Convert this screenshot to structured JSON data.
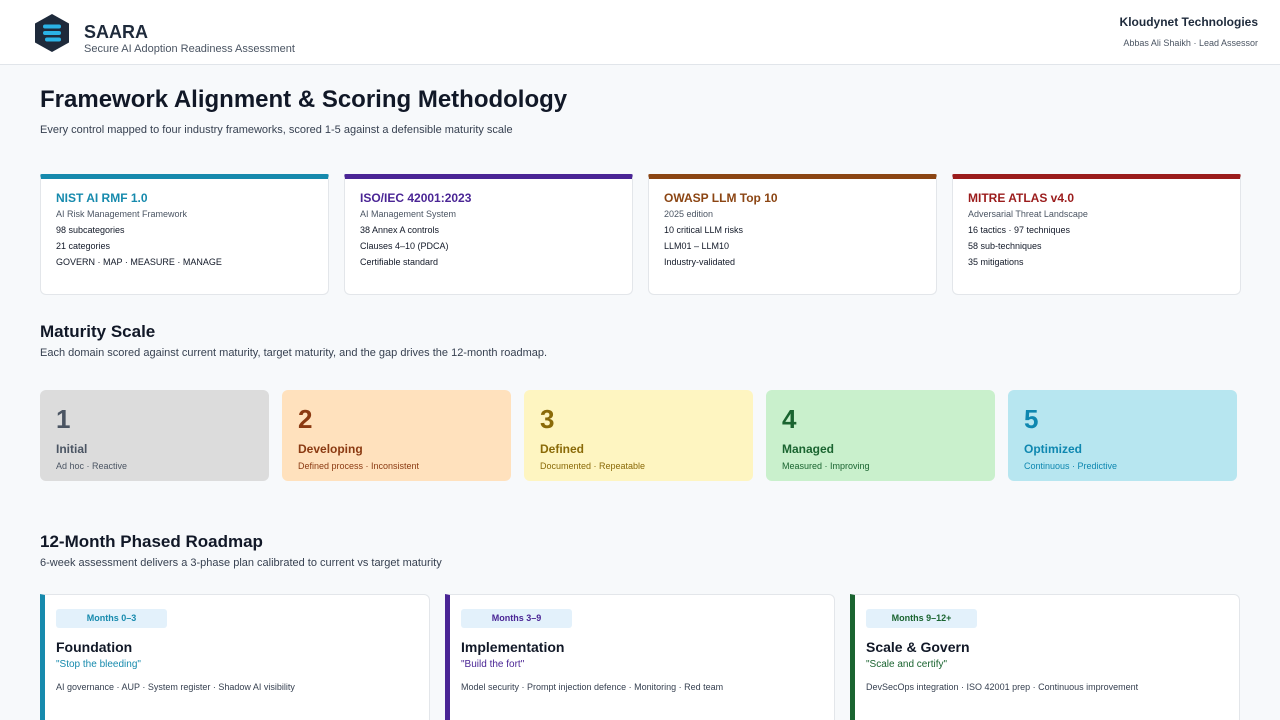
{
  "header": {
    "brand": "SAARA",
    "subtitle": "Secure AI Adoption Readiness Assessment",
    "company": "Kloudynet Technologies",
    "assessor_name": "Abbas Ali Shaikh",
    "assessor_sep": "·",
    "assessor_role": "Lead Assessor",
    "logo_icon": "stacked-layers-hexagon-icon"
  },
  "page": {
    "title": "Framework Alignment & Scoring Methodology",
    "subtitle": "Every control mapped to four industry frameworks, scored 1-5 against a defensible maturity scale"
  },
  "frameworks": [
    {
      "name": "NIST AI RMF 1.0",
      "desc": "AI Risk Management Framework",
      "lines": [
        "98 subcategories",
        "21 categories",
        "GOVERN · MAP · MEASURE · MANAGE"
      ],
      "color": "#168aad"
    },
    {
      "name": "ISO/IEC 42001:2023",
      "desc": "AI Management System",
      "lines": [
        "38 Annex A controls",
        "Clauses 4–10 (PDCA)",
        "Certifiable standard"
      ],
      "color": "#4a2595"
    },
    {
      "name": "OWASP LLM Top 10",
      "desc": "2025 edition",
      "lines": [
        "10 critical LLM risks",
        "LLM01 – LLM10",
        "Industry-validated"
      ],
      "color": "#8b4513"
    },
    {
      "name": "MITRE ATLAS v4.0",
      "desc": "Adversarial Threat Landscape",
      "lines": [
        "16 tactics · 97 techniques",
        "58 sub-techniques",
        "35 mitigations"
      ],
      "color": "#9b1c1c"
    }
  ],
  "maturity": {
    "title": "Maturity Scale",
    "subtitle": "Each domain scored against current maturity, target maturity, and the gap drives the 12-month roadmap.",
    "levels": [
      {
        "num": "1",
        "name": "Initial",
        "desc": "Ad hoc · Reactive",
        "bg": "#dcdcdc",
        "fg": "#4b5563"
      },
      {
        "num": "2",
        "name": "Developing",
        "desc": "Defined process · Inconsistent",
        "bg": "#ffe1bd",
        "fg": "#8b3a12"
      },
      {
        "num": "3",
        "name": "Defined",
        "desc": "Documented · Repeatable",
        "bg": "#fef5c1",
        "fg": "#8a6a08"
      },
      {
        "num": "4",
        "name": "Managed",
        "desc": "Measured · Improving",
        "bg": "#c9f0cc",
        "fg": "#1a6430"
      },
      {
        "num": "5",
        "name": "Optimized",
        "desc": "Continuous · Predictive",
        "bg": "#b7e6f0",
        "fg": "#0e87b0"
      }
    ]
  },
  "roadmap": {
    "title": "12-Month Phased Roadmap",
    "subtitle": "6-week assessment delivers a 3-phase plan calibrated to current vs target maturity",
    "phases": [
      {
        "pill": "Months 0–3",
        "name": "Foundation",
        "quote": "\"Stop the bleeding\"",
        "items": "AI governance · AUP · System register · Shadow AI visibility",
        "color": "#168aad"
      },
      {
        "pill": "Months 3–9",
        "name": "Implementation",
        "quote": "\"Build the fort\"",
        "items": "Model security · Prompt injection defence · Monitoring · Red team",
        "color": "#4a2595"
      },
      {
        "pill": "Months 9–12+",
        "name": "Scale & Govern",
        "quote": "\"Scale and certify\"",
        "items": "DevSecOps integration · ISO 42001 prep · Continuous improvement",
        "color": "#1a6430"
      }
    ]
  }
}
